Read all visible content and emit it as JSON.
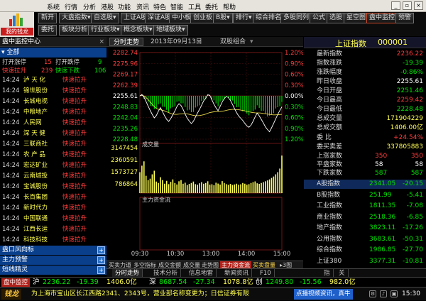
{
  "menu": [
    "系统",
    "行情",
    "分析",
    "港股",
    "功能",
    "资讯",
    "特色",
    "智能",
    "工具",
    "委托",
    "帮助"
  ],
  "logo": {
    "label": "我的钱龙"
  },
  "toolbar1": [
    "新开",
    "大盘指数▾",
    "自选股▾",
    "上证A股",
    "深证A股",
    "中小板",
    "创业板",
    "B股▾",
    "排行▾",
    "综合排名",
    "多股同列",
    "公式",
    "选股",
    "星空图",
    "盘中监控",
    "预警"
  ],
  "toolbar2": [
    "委托",
    "板块分析",
    "行业板块▾",
    "概念板块▾",
    "地域板块▾"
  ],
  "left": {
    "title": "盘中监控中心",
    "close": "×",
    "all": "▾ 全部",
    "summary": [
      {
        "a": "打开涨停",
        "av": "15",
        "b": "打开跌停",
        "bv": "9"
      },
      {
        "a": "快速拉升",
        "av": "239",
        "b": "快速下跌",
        "bv": "106"
      }
    ],
    "rows": [
      {
        "time": "14:24",
        "name": "泸 天 化",
        "event": "快速拉升"
      },
      {
        "time": "14:24",
        "name": "锦世股份",
        "event": "快速拉升"
      },
      {
        "time": "14:24",
        "name": "长城电视",
        "event": "快速拉升"
      },
      {
        "time": "14:24",
        "name": "中粮地产",
        "event": "快速拉升"
      },
      {
        "time": "14:24",
        "name": "人民网",
        "event": "快速拉升"
      },
      {
        "time": "14:24",
        "name": "深 天 健",
        "event": "快速拉升"
      },
      {
        "time": "14:24",
        "name": "三联商社",
        "event": "快速拉升"
      },
      {
        "time": "14:24",
        "name": "农 产 品",
        "event": "快速拉升"
      },
      {
        "time": "14:24",
        "name": "宏达矿业",
        "event": "快速拉升"
      },
      {
        "time": "14:24",
        "name": "云南城投",
        "event": "快速拉升"
      },
      {
        "time": "14:24",
        "name": "宝诚股份",
        "event": "快速拉升"
      },
      {
        "time": "14:24",
        "name": "长百集团",
        "event": "快速拉升"
      },
      {
        "time": "14:24",
        "name": "新时代力",
        "event": "快速拉升"
      },
      {
        "time": "14:24",
        "name": "中国联通",
        "event": "快速拉升"
      },
      {
        "time": "14:24",
        "name": "江西长运",
        "event": "快速拉升"
      },
      {
        "time": "14:24",
        "name": "科技科技",
        "event": "快速拉升"
      }
    ],
    "sections": [
      "盘口风向标",
      "主力预警",
      "短线精灵"
    ]
  },
  "chart_header": {
    "tab": "分时走势",
    "date": "2013年09月13日",
    "combo": "双股组合"
  },
  "chart_data": {
    "type": "line",
    "title": "",
    "price_ticks": [
      "2282.74",
      "2275.96",
      "2269.17",
      "2262.39",
      "2255.61",
      "2248.83",
      "2242.04",
      "2235.26",
      "2228.48"
    ],
    "pct_ticks": [
      "1.20%",
      "0.90%",
      "0.60%",
      "0.30%",
      "0.00%",
      "0.30%",
      "0.60%",
      "0.90%",
      "1.20%"
    ],
    "volume_label": "成交量",
    "volume_ticks": [
      "3147454",
      "2360591",
      "1573727",
      "786864"
    ],
    "flow_label": "主力资金流",
    "time_ticks": [
      "09:30",
      "10:30",
      "13:00",
      "14:00",
      "15:00"
    ],
    "base": 2255.61,
    "price_series": [
      2255.6,
      2256.4,
      2254.8,
      2252.1,
      2249.2,
      2246.5,
      2244.0,
      2241.8,
      2243.3,
      2246.0,
      2248.2,
      2245.7,
      2243.1,
      2240.9,
      2239.6,
      2241.4,
      2243.8,
      2246.1,
      2248.9,
      2250.7,
      2249.5,
      2247.1,
      2244.2,
      2241.5,
      2239.8,
      2238.2,
      2239.7,
      2242.3,
      2244.9,
      2247.2,
      2249.8,
      2252.5,
      2254.1,
      2256.3,
      2255.8,
      2253.1,
      2250.4,
      2248.2,
      2246.3,
      2249.0,
      2251.7,
      2253.9,
      2255.2,
      2254.6,
      2252.8,
      2250.3,
      2247.6,
      2245.1,
      2243.0,
      2241.6,
      2240.2,
      2238.4,
      2236.8,
      2235.9,
      2237.2,
      2239.6,
      2242.4,
      2244.8,
      2243.1,
      2240.9,
      2238.6,
      2236.2,
      2234.5,
      2233.1,
      2235.6,
      2238.3,
      2241.2,
      2243.9,
      2246.4,
      2248.7
    ],
    "avg_series": [
      2255.6,
      2255.9,
      2255.5,
      2254.6,
      2253.3,
      2251.9,
      2250.3,
      2248.9,
      2247.8,
      2247.2,
      2246.9,
      2246.6,
      2246.2,
      2245.7,
      2245.1,
      2244.6,
      2244.2,
      2244.0,
      2244.0,
      2244.2,
      2244.3,
      2244.4,
      2244.4,
      2244.3,
      2244.0,
      2243.7,
      2243.4,
      2243.2,
      2243.2,
      2243.3,
      2243.5,
      2243.8,
      2244.2,
      2244.7,
      2245.1,
      2245.4,
      2245.6,
      2245.7,
      2245.7,
      2245.8,
      2246.0,
      2246.2,
      2246.5,
      2246.8,
      2247.0,
      2247.1,
      2247.1,
      2247.0,
      2246.9,
      2246.7,
      2246.5,
      2246.2,
      2245.9,
      2245.6,
      2245.3,
      2245.1,
      2245.0,
      2244.9,
      2244.9,
      2244.8,
      2244.6,
      2244.4,
      2244.2,
      2244.0,
      2243.8,
      2243.7,
      2243.7,
      2243.8,
      2243.9,
      2244.0
    ],
    "volume": [
      1450000,
      1900000,
      2200000,
      1200000,
      900000,
      1000000,
      1300000,
      1550000,
      800000,
      700000,
      1100000,
      900000,
      650000,
      850000,
      620000,
      780000,
      950000,
      700000,
      600000,
      820000,
      900000,
      650000,
      720000,
      560000,
      640000,
      700000,
      800000,
      620000,
      580000,
      680000,
      760000,
      650000,
      700000,
      820000,
      590000,
      610000,
      550000,
      720000,
      660000,
      590000,
      830000,
      700000,
      620000,
      570000,
      640000,
      560000,
      600000,
      650000,
      580000,
      610000,
      700000,
      650000,
      580000,
      620000,
      700000,
      760000,
      810000,
      680000,
      640000,
      700000,
      760000,
      820000,
      880000,
      950000,
      1050000,
      1150000,
      1300000,
      1450000,
      1700000,
      2600000
    ],
    "ylim": [
      2228.48,
      2282.74
    ]
  },
  "chart_tabs": [
    "买卖力道",
    "多空指标",
    "成交金额",
    "成交量",
    "走势图",
    "主力资金流",
    "买卖盘量",
    "▸3图"
  ],
  "bottom_tabs": [
    "分时走势",
    "技术分析",
    "信息地雷",
    "新闻资讯",
    "F10",
    "指",
    "关"
  ],
  "right": {
    "title": "上证指数",
    "code": "000001",
    "stats": [
      {
        "k": "最新指数",
        "v": "2236.22",
        "c": "red"
      },
      {
        "k": "指数涨跌",
        "v": "-19.39",
        "c": "grn"
      },
      {
        "k": "涨跌幅度",
        "v": "-0.86%",
        "c": "grn"
      },
      {
        "k": "昨日收盘",
        "v": "2255.61",
        "c": "wht"
      },
      {
        "k": "今日开盘",
        "v": "2251.46",
        "c": "grn"
      },
      {
        "k": "今日最高",
        "v": "2259.42",
        "c": "red"
      },
      {
        "k": "今日最低",
        "v": "2228.48",
        "c": "grn"
      },
      {
        "k": "总成交量",
        "v": "171904229",
        "c": "yel"
      },
      {
        "k": "总成交额",
        "v": "1406.00亿",
        "c": "yel"
      }
    ],
    "ratio": [
      {
        "k": "委 比",
        "v": "+24.54%",
        "c": "red"
      },
      {
        "k": "委买卖差",
        "v": "337805883",
        "c": "yel"
      }
    ],
    "updown": [
      {
        "k": "上涨家数",
        "a": "350",
        "b": "350"
      },
      {
        "k": "平盘家数",
        "a": "58",
        "b": "58"
      },
      {
        "k": "下跌家数",
        "a": "587",
        "b": "587"
      }
    ],
    "indices": [
      {
        "k": "A股指数",
        "v": "2341.05",
        "d": "-20.15"
      },
      {
        "k": "B股指数",
        "v": "251.99",
        "d": "-5.41"
      },
      {
        "k": "工业指数",
        "v": "1811.35",
        "d": "-7.08"
      },
      {
        "k": "商业指数",
        "v": "2518.36",
        "d": "-6.85"
      },
      {
        "k": "地产指数",
        "v": "3823.11",
        "d": "-17.26"
      },
      {
        "k": "公用指数",
        "v": "3683.61",
        "d": "-50.31"
      },
      {
        "k": "综合指数",
        "v": "1986.85",
        "d": "-27.70"
      },
      {
        "k": "上证380",
        "v": "3377.31",
        "d": "-10.81"
      }
    ]
  },
  "ticker": {
    "monitor": "盘中监控",
    "items": [
      {
        "t": "沪",
        "v": "2236.22",
        "d": "-19.39",
        "a": "1406.0亿"
      },
      {
        "t": "深",
        "v": "8687.54",
        "d": "-27.34",
        "a": "1078.8亿"
      },
      {
        "t": "创",
        "v": "1249.80",
        "d": "-15.56",
        "a": "982.0亿"
      }
    ]
  },
  "news": {
    "logo": "钱龙",
    "text": "为上海市宝山区长江西路2341、2343号，营业部名称变更为；日信证券有限",
    "badge": "点播视频资讯，真牛",
    "time": "15:30"
  }
}
